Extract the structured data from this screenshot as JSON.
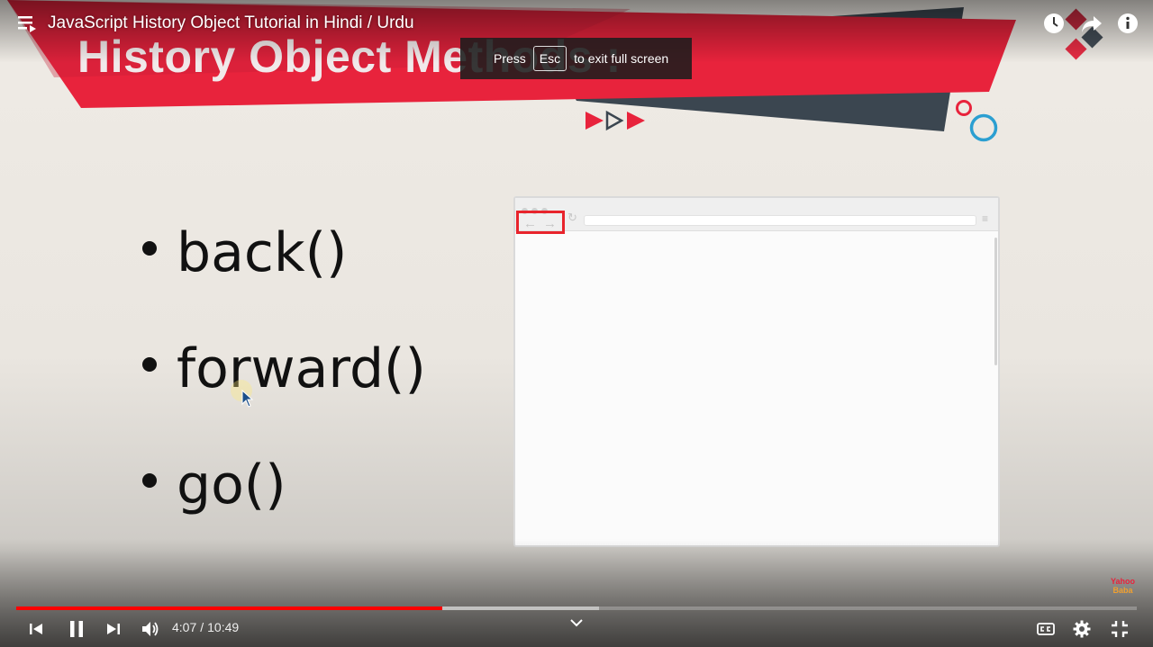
{
  "video": {
    "title": "JavaScript History Object Tutorial in Hindi / Urdu",
    "progress_fraction": 0.38,
    "buffered_fraction": 0.52
  },
  "slide": {
    "heading": "History Object Methods :",
    "bullets": [
      "back()",
      "forward()",
      "go()"
    ]
  },
  "toast": {
    "prefix": "Press",
    "key": "Esc",
    "suffix": "to exit full screen"
  },
  "controls": {
    "current_time": "4:07",
    "separator": "/",
    "duration": "10:49"
  },
  "watermark": {
    "line1": "Yahoo",
    "line2": "Baba"
  },
  "icons": {
    "playlist": "playlist-icon",
    "watch_later": "clock-icon",
    "share": "share-icon",
    "info": "info-icon",
    "previous": "skip-previous-icon",
    "pause": "pause-icon",
    "next": "skip-next-icon",
    "volume": "volume-icon",
    "chevron": "chevron-down-icon",
    "captions": "captions-icon",
    "settings": "gear-icon",
    "exit_fullscreen": "exit-fullscreen-icon"
  },
  "colors": {
    "accent_red": "#e8233c",
    "dark_band": "#3b4650",
    "progress_red": "#ff0000",
    "circle_blue": "#2b9fd1"
  }
}
